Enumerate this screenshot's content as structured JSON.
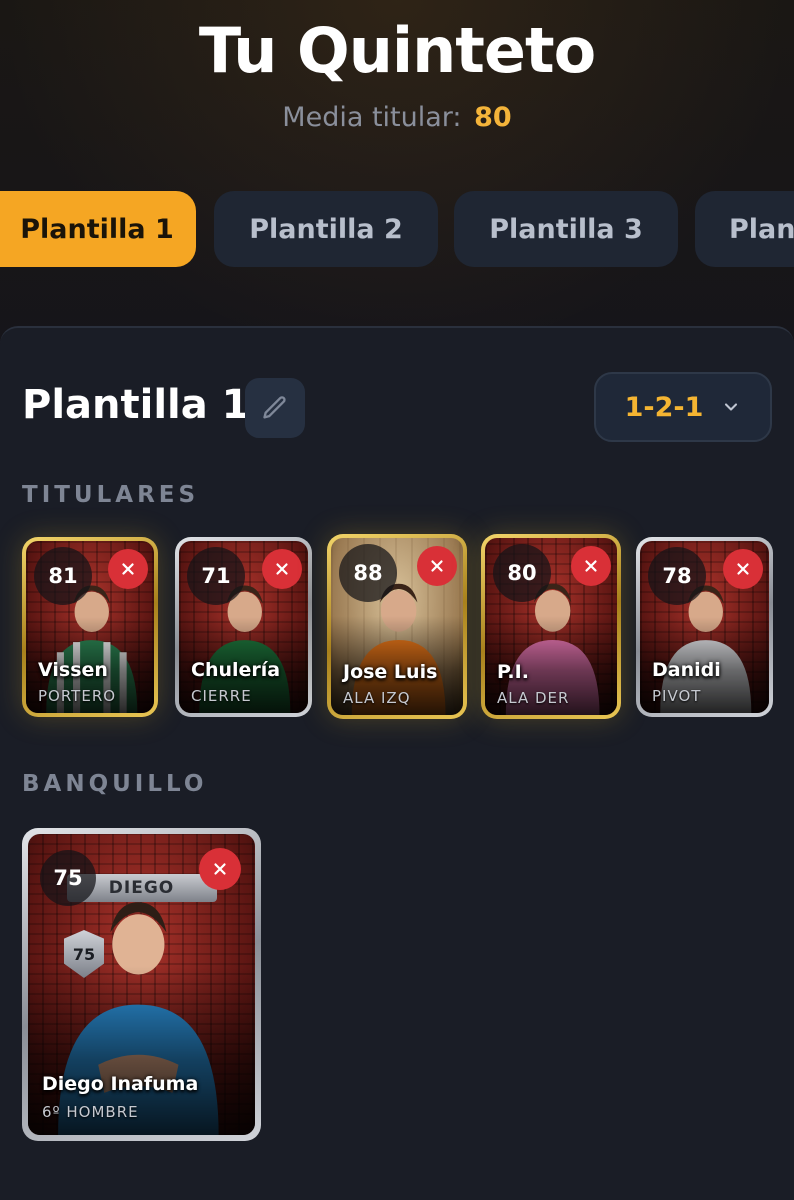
{
  "header": {
    "title": "Tu Quinteto",
    "avg_label": "Media titular:",
    "avg_value": "80"
  },
  "tabs": [
    {
      "label": "Plantilla 1",
      "active": true
    },
    {
      "label": "Plantilla 2",
      "active": false
    },
    {
      "label": "Plantilla 3",
      "active": false
    },
    {
      "label": "Plan",
      "active": false
    }
  ],
  "squad": {
    "name": "Plantilla 1",
    "edit_icon": "pencil-icon",
    "formation": "1-2-1",
    "formation_icon": "chevron-down-icon"
  },
  "sections": {
    "starters_label": "TITULARES",
    "bench_label": "BANQUILLO"
  },
  "starters": [
    {
      "rating": "81",
      "name": "Vissen",
      "position": "PORTERO",
      "tier": "gold",
      "kit": "#2e8b57",
      "kit2": "#ffffff"
    },
    {
      "rating": "71",
      "name": "Chulería",
      "position": "CIERRE",
      "tier": "silver",
      "kit": "#1f7a3e",
      "kit2": "#1f7a3e"
    },
    {
      "rating": "88",
      "name": "Jose Luis",
      "position": "ALA IZQ",
      "tier": "gold",
      "kit": "#f07a1a",
      "kit2": "#f07a1a"
    },
    {
      "rating": "80",
      "name": "P.I.",
      "position": "ALA DER",
      "tier": "gold",
      "kit": "#f07ab8",
      "kit2": "#f07ab8"
    },
    {
      "rating": "78",
      "name": "Danidi",
      "position": "PIVOT",
      "tier": "silver",
      "kit": "#e9eaee",
      "kit2": "#e9eaee"
    }
  ],
  "bench": [
    {
      "rating": "75",
      "name": "Diego Inafuma",
      "position": "6º HOMBRE",
      "tier": "silver",
      "banner": "DIEGO",
      "badge": "75",
      "kit": "#2b8fd6"
    }
  ],
  "colors": {
    "accent": "#f5a623",
    "remove": "#d93037",
    "background": "#14161d",
    "panel": "#1a1d26"
  }
}
